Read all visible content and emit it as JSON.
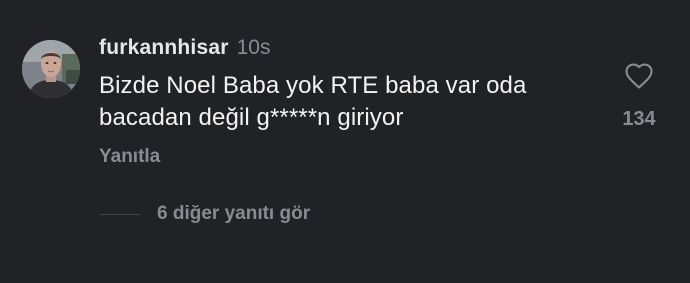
{
  "comment": {
    "username": "furkannhisar",
    "timestamp": "10s",
    "text": "Bizde Noel Baba yok RTE baba var oda bacadan değil g*****n giriyor",
    "reply_label": "Yanıtla",
    "like_count": "134",
    "more_replies_label": "6 diğer yanıtı gör"
  },
  "icons": {
    "like": "heart-outline-icon",
    "avatar": "profile-photo"
  },
  "colors": {
    "background": "#212226",
    "primary_text": "#f2f2f3",
    "secondary_text": "#8a8b90"
  }
}
